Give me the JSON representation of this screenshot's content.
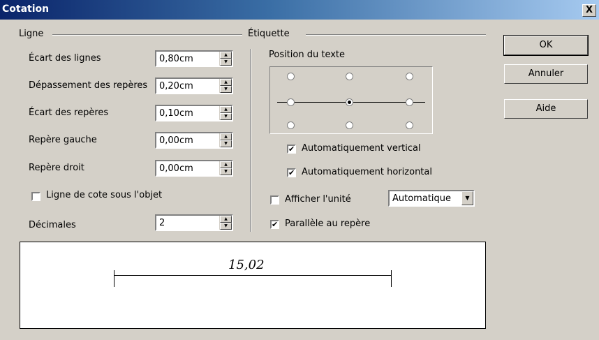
{
  "window": {
    "title": "Cotation",
    "close_glyph": "X"
  },
  "ligne": {
    "group_label": "Ligne",
    "fields": [
      {
        "label": "Écart des lignes",
        "value": "0,80cm"
      },
      {
        "label": "Dépassement des repères",
        "value": "0,20cm"
      },
      {
        "label": "Écart des repères",
        "value": "0,10cm"
      },
      {
        "label": "Repère gauche",
        "value": "0,00cm"
      },
      {
        "label": "Repère droit",
        "value": "0,00cm"
      }
    ],
    "sous_objet_label": "Ligne de cote sous l'objet",
    "sous_objet_checked": false,
    "decimales_label": "Décimales",
    "decimales_value": "2"
  },
  "etiquette": {
    "group_label": "Étiquette",
    "position_label": "Position du texte",
    "selected_position": "middle-center",
    "auto_vertical_label": "Automatiquement vertical",
    "auto_vertical_checked": true,
    "auto_horizontal_label": "Automatiquement horizontal",
    "auto_horizontal_checked": true,
    "afficher_unite_label": "Afficher l'unité",
    "afficher_unite_checked": false,
    "unite_value": "Automatique",
    "parallele_label": "Parallèle au repère",
    "parallele_checked": true
  },
  "buttons": {
    "ok": "OK",
    "annuler": "Annuler",
    "aide": "Aide"
  },
  "preview": {
    "value_text": "15,02"
  }
}
